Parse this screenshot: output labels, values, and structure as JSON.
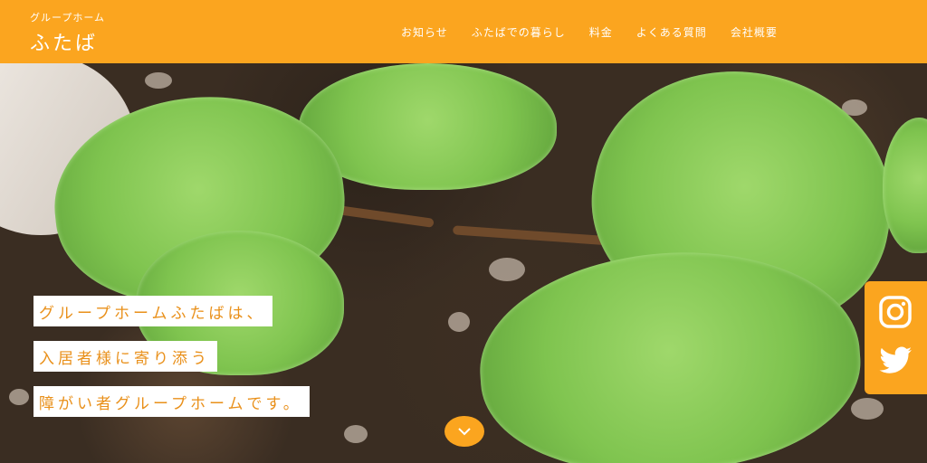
{
  "header": {
    "brand_sub": "グループホーム",
    "brand_title": "ふたば"
  },
  "nav": {
    "items": [
      {
        "label": "お知らせ"
      },
      {
        "label": "ふたばでの暮らし"
      },
      {
        "label": "料金"
      },
      {
        "label": "よくある質問"
      },
      {
        "label": "会社概要"
      }
    ]
  },
  "hero": {
    "catch_lines": [
      "グループホームふたばは、",
      "入居者様に寄り添う",
      "障がい者グループホームです。"
    ],
    "scroll_icon": "chevron-down-icon"
  },
  "social": {
    "icons": [
      "instagram-icon",
      "twitter-icon"
    ]
  },
  "colors": {
    "accent": "#fba51f",
    "catch_text": "#e9901a",
    "white": "#ffffff"
  }
}
